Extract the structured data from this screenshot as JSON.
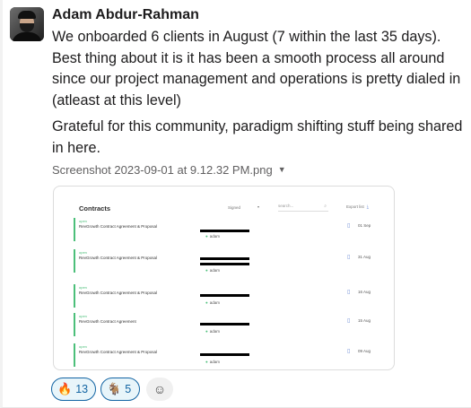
{
  "message": {
    "author": "Adam Abdur-Rahman",
    "paragraphs": [
      "We onboarded 6 clients in August (7 within the last 35 days). Best thing about it is it has been a smooth process all around since our project management and operations is pretty dialed in (atleast at this level)",
      "Grateful for this community, paradigm shifting stuff being shared in here."
    ],
    "attachment": {
      "filename": "Screenshot 2023-09-01 at 9.12.32 PM.png",
      "caret": "▼"
    }
  },
  "screenshot": {
    "title": "Contracts",
    "filter_label": "Signed",
    "filter_caret": "▾",
    "search_placeholder": "search...",
    "search_icon": "⌕",
    "export_label": "Export list",
    "export_icon": "⤓",
    "rows": [
      {
        "status": "open",
        "name": "RevGrowth Contract Agreement & Proposal",
        "owner": "adam",
        "date": "01 Sep"
      },
      {
        "status": "open",
        "name": "RevGrowth Contract Agreement & Proposal",
        "owner": "adam",
        "date": "31 Aug"
      },
      {
        "status": "open",
        "name": "RevGrowth Contract Agreement & Proposal",
        "owner": "adam",
        "date": "16 Aug"
      },
      {
        "status": "open",
        "name": "RevGrowth Contract Agreement",
        "owner": "adam",
        "date": "15 Aug"
      },
      {
        "status": "open",
        "name": "RevGrowth Contract Agreement & Proposal",
        "owner": "adam",
        "date": "09 Aug"
      }
    ]
  },
  "reactions": [
    {
      "emoji": "🔥",
      "icon": "fire-emoji",
      "count": "13"
    },
    {
      "emoji": "🐐",
      "icon": "goat-emoji",
      "count": "5"
    }
  ],
  "add_reaction_icon": "☺",
  "colors": {
    "accent": "#1264a3",
    "status_green": "#4cbf7a"
  }
}
